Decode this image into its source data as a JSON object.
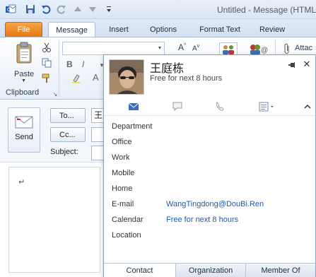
{
  "window": {
    "title": "Untitled - Message (HTML"
  },
  "quick_access": [
    {
      "name": "outlook-app-icon"
    },
    {
      "name": "save-icon"
    },
    {
      "name": "undo-icon"
    },
    {
      "name": "redo-icon"
    },
    {
      "name": "up-arrow-icon"
    },
    {
      "name": "down-arrow-icon"
    },
    {
      "name": "customize-qat-icon"
    }
  ],
  "tabs": [
    {
      "label": "File"
    },
    {
      "label": "Message"
    },
    {
      "label": "Insert"
    },
    {
      "label": "Options"
    },
    {
      "label": "Format Text"
    },
    {
      "label": "Review"
    }
  ],
  "ribbon": {
    "paste_label": "Paste",
    "clipboard_group": "Clipboard",
    "bold": "B",
    "italic": "I",
    "text_color": "A",
    "grow_font": "A",
    "shrink_font": "A",
    "attach_label": "Attac"
  },
  "compose": {
    "send_label": "Send",
    "to_label": "To...",
    "to_value": "王",
    "cc_label": "Cc...",
    "subject_label": "Subject:",
    "paragraph_mark": "↵"
  },
  "contact_card": {
    "name": "王庭栋",
    "status": "Free for next 8 hours",
    "fields": [
      {
        "label": "Department",
        "value": ""
      },
      {
        "label": "Office",
        "value": ""
      },
      {
        "label": "Work",
        "value": ""
      },
      {
        "label": "Mobile",
        "value": ""
      },
      {
        "label": "Home",
        "value": ""
      },
      {
        "label": "E-mail",
        "value": "WangTingdong@DouBi.Ren"
      },
      {
        "label": "Calendar",
        "value": "Free for next 8 hours"
      },
      {
        "label": "Location",
        "value": ""
      }
    ],
    "tabs": [
      {
        "label": "Contact"
      },
      {
        "label": "Organization"
      },
      {
        "label": "Member Of"
      }
    ]
  },
  "colors": {
    "accent_blue": "#1f5aa5",
    "file_tab": "#e7750f",
    "ribbon_bg": "#e6eef8"
  }
}
